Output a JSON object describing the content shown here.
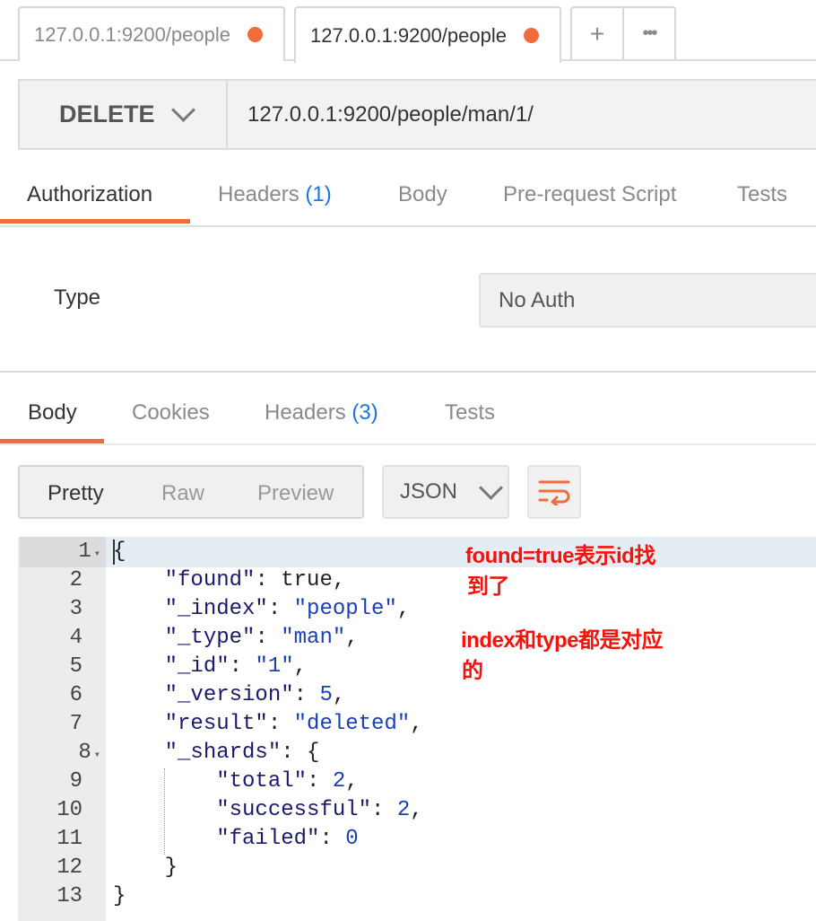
{
  "tabs": [
    {
      "title": "127.0.0.1:9200/people"
    },
    {
      "title": "127.0.0.1:9200/people"
    }
  ],
  "tab_actions": {
    "new": "+",
    "more": "•••"
  },
  "request": {
    "method": "DELETE",
    "url": "127.0.0.1:9200/people/man/1/"
  },
  "request_tabs": {
    "authorization": "Authorization",
    "headers": "Headers",
    "headers_count": "(1)",
    "body": "Body",
    "prerequest": "Pre-request Script",
    "tests": "Tests"
  },
  "auth": {
    "type_label": "Type",
    "type_value": "No Auth"
  },
  "response_tabs": {
    "body": "Body",
    "cookies": "Cookies",
    "headers": "Headers",
    "headers_count": "(3)",
    "tests": "Tests"
  },
  "view_modes": {
    "pretty": "Pretty",
    "raw": "Raw",
    "preview": "Preview"
  },
  "format": "JSON",
  "line_numbers": [
    "1",
    "2",
    "3",
    "4",
    "5",
    "6",
    "7",
    "8",
    "9",
    "10",
    "11",
    "12",
    "13"
  ],
  "response_lines": [
    "{",
    "    \"found\": true,",
    "    \"_index\": \"people\",",
    "    \"_type\": \"man\",",
    "    \"_id\": \"1\",",
    "    \"_version\": 5,",
    "    \"result\": \"deleted\",",
    "    \"_shards\": {",
    "        \"total\": 2,",
    "        \"successful\": 2,",
    "        \"failed\": 0",
    "    }",
    "}"
  ],
  "annotations": {
    "a1_line1": "found=true表示id找",
    "a1_line2": "到了",
    "a2_line1": "index和type都是对应",
    "a2_line2": "的"
  },
  "colors": {
    "accent": "#f26b3a",
    "annotation": "#f2140c",
    "count": "#1a73e8"
  }
}
